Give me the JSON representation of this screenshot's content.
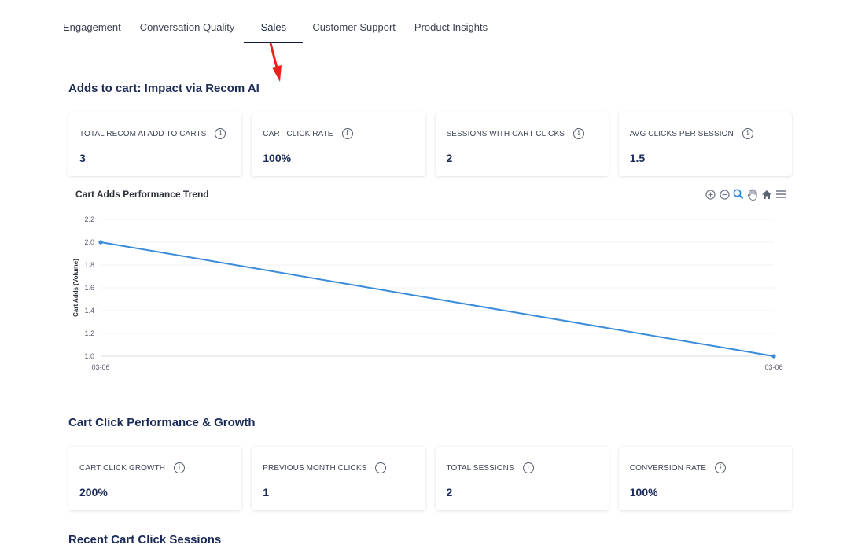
{
  "tabs": [
    {
      "label": "Engagement"
    },
    {
      "label": "Conversation Quality"
    },
    {
      "label": "Sales"
    },
    {
      "label": "Customer Support"
    },
    {
      "label": "Product Insights"
    }
  ],
  "active_tab": "Sales",
  "section1": {
    "title": "Adds to cart: Impact via Recom AI",
    "cards": [
      {
        "label": "TOTAL RECOM AI ADD TO CARTS",
        "value": "3"
      },
      {
        "label": "CART CLICK RATE",
        "value": "100%"
      },
      {
        "label": "SESSIONS WITH CART CLICKS",
        "value": "2"
      },
      {
        "label": "AVG CLICKS PER SESSION",
        "value": "1.5"
      }
    ]
  },
  "chart_section": {
    "title": "Cart Adds Performance Trend",
    "toolbar": [
      "zoom-in-icon",
      "zoom-out-icon",
      "selection-zoom-icon",
      "pan-hand-icon",
      "home-icon",
      "menu-icon"
    ]
  },
  "chart_data": {
    "type": "line",
    "title": "Cart Adds Performance Trend",
    "xlabel": "",
    "ylabel": "Cart Adds (Volume)",
    "x": [
      "03-06",
      "03-06"
    ],
    "series": [
      {
        "values": [
          2.0,
          1.0
        ]
      }
    ],
    "ylim": [
      1.0,
      2.2
    ],
    "yticks": [
      "1.0",
      "1.2",
      "1.4",
      "1.6",
      "1.8",
      "2.0",
      "2.2"
    ],
    "grid": true,
    "color": "#3a8bd9"
  },
  "section2": {
    "title": "Cart Click Performance & Growth",
    "cards": [
      {
        "label": "CART CLICK GROWTH",
        "value": "200%"
      },
      {
        "label": "PREVIOUS MONTH CLICKS",
        "value": "1"
      },
      {
        "label": "TOTAL SESSIONS",
        "value": "2"
      },
      {
        "label": "CONVERSION RATE",
        "value": "100%"
      }
    ]
  },
  "section3": {
    "title": "Recent Cart Click Sessions"
  },
  "info_icon_glyph": "i",
  "colors": {
    "accent": "#1b2a57",
    "tab_underline": "#0d1b3e",
    "line": "#3a8bd9",
    "arrow": "#e8231c"
  }
}
